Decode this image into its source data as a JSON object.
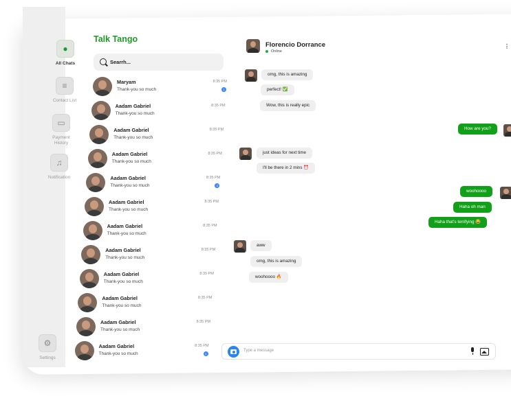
{
  "app": {
    "brand": "Talk Tango"
  },
  "nav": [
    {
      "label": "All Chats",
      "icon": "chat-bubble-icon",
      "active": true
    },
    {
      "label": "Contact List",
      "icon": "contact-list-icon",
      "active": false
    },
    {
      "label": "Payment History",
      "icon": "payment-history-icon",
      "active": false
    },
    {
      "label": "Notification",
      "icon": "bell-icon",
      "active": false
    },
    {
      "label": "Settings",
      "icon": "gear-icon",
      "active": false
    }
  ],
  "search": {
    "placeholder": "Searrh..."
  },
  "chats": [
    {
      "name": "Maryam",
      "message": "Thank-you so much",
      "time": "8:35 PM",
      "unread": "1"
    },
    {
      "name": "Aadam Gabriel",
      "message": "Thank-you so much",
      "time": "8:35 PM",
      "unread": ""
    },
    {
      "name": "Aadam Gabriel",
      "message": "Thank-you so much",
      "time": "8:35 PM",
      "unread": ""
    },
    {
      "name": "Aadam Gabriel",
      "message": "Thank-you so much",
      "time": "8:35 PM",
      "unread": ""
    },
    {
      "name": "Aadam Gabriel",
      "message": "Thank-you so much",
      "time": "8:35 PM",
      "unread": "1"
    },
    {
      "name": "Aadam Gabriel",
      "message": "Thank-you so much",
      "time": "8:35 PM",
      "unread": ""
    },
    {
      "name": "Aadam Gabriel",
      "message": "Thank-you so much",
      "time": "8:35 PM",
      "unread": ""
    },
    {
      "name": "Aadam Gabriel",
      "message": "Thank-you so much",
      "time": "8:35 PM",
      "unread": ""
    },
    {
      "name": "Aadam Gabriel",
      "message": "Thank-you so much",
      "time": "8:35 PM",
      "unread": ""
    },
    {
      "name": "Aadam Gabriel",
      "message": "Thank-you so much",
      "time": "8:35 PM",
      "unread": ""
    },
    {
      "name": "Aadam Gabriel",
      "message": "Thank-you so much",
      "time": "8:35 PM",
      "unread": ""
    },
    {
      "name": "Aadam Gabriel",
      "message": "Thank-you so much",
      "time": "8:35 PM",
      "unread": "1"
    }
  ],
  "conversation": {
    "contact_name": "Florencio Dorrance",
    "status": "Online",
    "more_icon": "more-icon",
    "messages": [
      {
        "side": "in",
        "text": "omg, this is amazing"
      },
      {
        "side": "in",
        "text": "perfect! ✅"
      },
      {
        "side": "in",
        "text": "Wow, this is really epic"
      },
      {
        "side": "out",
        "text": "How are you?"
      },
      {
        "side": "in",
        "text": "just ideas for next time"
      },
      {
        "side": "in",
        "text": "I'll be there in 2 mins ⏰"
      },
      {
        "side": "out",
        "text": "woohoooo"
      },
      {
        "side": "out",
        "text": "Haha oh man"
      },
      {
        "side": "out",
        "text": "Haha that's terrifying 😂"
      },
      {
        "side": "in",
        "text": "aww"
      },
      {
        "side": "in",
        "text": "omg, this is amazing"
      },
      {
        "side": "in",
        "text": "woohoooo 🔥"
      }
    ]
  },
  "composer": {
    "placeholder": "Type a message"
  },
  "colors": {
    "accent": "#1f9a2a",
    "out_bubble": "#12a01a",
    "badge": "#3a86ff"
  }
}
